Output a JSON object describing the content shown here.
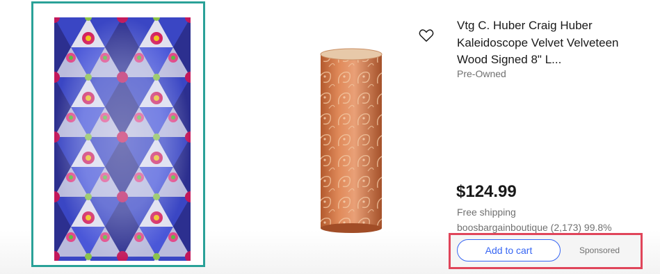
{
  "listing": {
    "title": "Vtg C. Huber Craig Huber Kaleidoscope Velvet Velveteen Wood Signed 8\" L...",
    "condition": "Pre-Owned",
    "price": "$124.99",
    "shipping": "Free shipping",
    "seller": "boosbargainboutique (2,173) 99.8%"
  },
  "actions": {
    "add_to_cart_label": "Add to cart",
    "sponsored_label": "Sponsored"
  },
  "icons": {
    "watch": "heart-icon"
  },
  "colors": {
    "left_highlight": "#2aa198",
    "action_highlight": "#e0455a",
    "accent_blue": "#3665f3",
    "secondary_text": "#707070",
    "primary_text": "#191919"
  }
}
